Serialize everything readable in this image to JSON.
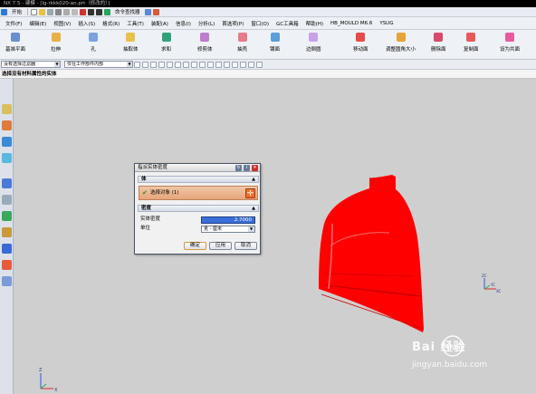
{
  "window": {
    "title": "NX 7.5 - 建模 - [lg-rkkk020-an.prt（修改的）]"
  },
  "menu": {
    "start_label": "开始",
    "items": [
      "文件(F)",
      "编辑(E)",
      "视图(V)",
      "插入(S)",
      "格式(R)",
      "工具(T)",
      "装配(A)",
      "信息(I)",
      "分析(L)",
      "首选项(P)",
      "窗口(O)",
      "GC工具箱",
      "帮助(H)",
      "HB_MOULD M6.6",
      "YSUG"
    ],
    "cmd_finder": "命令查找器"
  },
  "toolbar": {
    "buttons": [
      "基准平面",
      "拉伸",
      "孔",
      "抽取体",
      "求和",
      "修剪体",
      "抽壳",
      "镶面",
      "边倒圆",
      "移动面",
      "调整圆角大小",
      "删除面",
      "复制面",
      "设为共面"
    ]
  },
  "filter": {
    "type_filter": "没有选择过滤器",
    "scope": "仅在工作部件内部"
  },
  "cue": {
    "text": "选择没有材料属性的实体"
  },
  "dialog": {
    "title": "指派实体密度",
    "section_body": "体",
    "select_label": "选择对象 (1)",
    "section_density": "密度",
    "density_label": "实体密度",
    "density_value": "2.7000",
    "unit_label": "单位",
    "unit_value": "克 - 厘米",
    "ok": "确定",
    "apply": "应用",
    "cancel": "取消"
  },
  "csys": {
    "zc": "ZC",
    "yc": "YC",
    "xc": "XC",
    "z": "Z",
    "x": "X"
  },
  "watermark": {
    "brand": "Bai 经验",
    "paw": "du",
    "url": "jingyan.baidu.com"
  },
  "colors": {
    "body": "#ff0000",
    "accent_orange": "#f26d2a",
    "selection_bg": "#e7a57a"
  }
}
